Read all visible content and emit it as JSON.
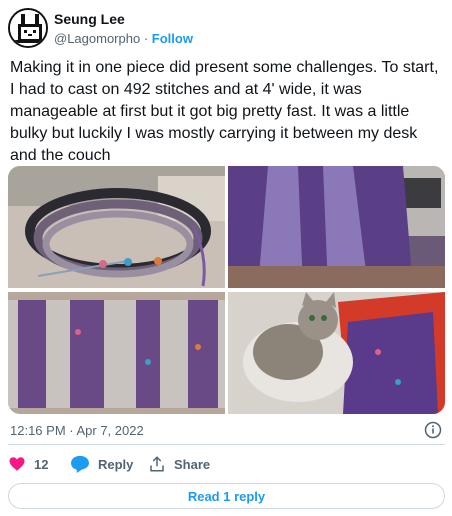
{
  "author": {
    "name": "Seung Lee",
    "handle": "@Lagomorpho",
    "separator": "·",
    "follow_label": "Follow"
  },
  "tweet": {
    "text": "Making it in one piece did present some challenges. To start, I had to cast on 492 stitches and at 4' wide, it was manageable at first but it got big pretty fast. It was a little bulky but luckily I was mostly carrying it between my desk and the couch",
    "timestamp": "12:16 PM · Apr 7, 2022"
  },
  "media": [
    {
      "icon": "knitting-ring-photo"
    },
    {
      "icon": "purple-knit-closeup-photo"
    },
    {
      "icon": "knit-panel-photo"
    },
    {
      "icon": "cat-on-knit-photo"
    }
  ],
  "actions": {
    "like_count": "12",
    "reply_label": "Reply",
    "share_label": "Share"
  },
  "replies": {
    "read_label": "Read 1 reply"
  },
  "colors": {
    "accent": "#1d9bf0",
    "like": "#f91880",
    "text_secondary": "#536471"
  }
}
